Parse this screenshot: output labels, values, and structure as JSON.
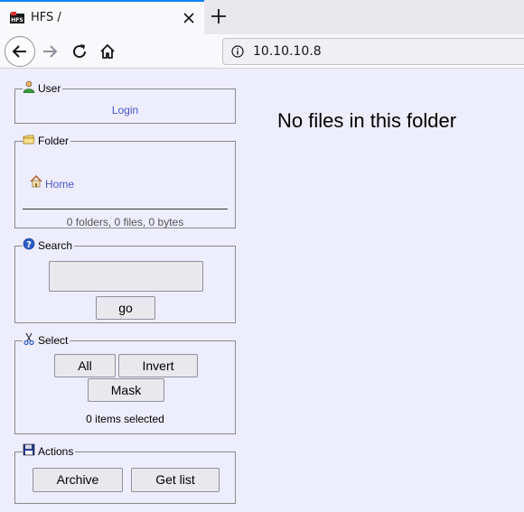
{
  "browser": {
    "tab": {
      "title": "HFS /",
      "favicon": "hfs-logo-icon"
    },
    "url": "10.10.10.8"
  },
  "panels": {
    "user": {
      "legend": "User",
      "icon": "user-icon",
      "login_link": "Login"
    },
    "folder": {
      "legend": "Folder",
      "icon": "folder-icon",
      "home_link": "Home",
      "summary": "0 folders, 0 files, 0 bytes"
    },
    "search": {
      "legend": "Search",
      "icon": "help-icon",
      "input_value": "",
      "go_label": "go"
    },
    "select": {
      "legend": "Select",
      "icon": "scissors-icon",
      "all_label": "All",
      "invert_label": "Invert",
      "mask_label": "Mask",
      "status": "0 items selected"
    },
    "actions": {
      "legend": "Actions",
      "icon": "floppy-disk-icon",
      "archive_label": "Archive",
      "getlist_label": "Get list"
    }
  },
  "main": {
    "empty_message": "No files in this folder"
  }
}
